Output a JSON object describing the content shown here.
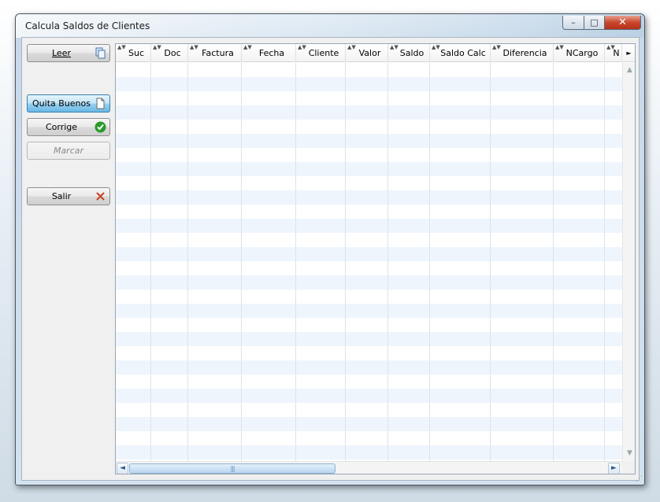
{
  "window": {
    "title": "Calcula Saldos de Clientes",
    "controls": {
      "minimize": "–",
      "maximize": "□",
      "close": "✕"
    }
  },
  "sidebar": {
    "buttons": [
      {
        "id": "leer",
        "label": "Leer",
        "icon": "copy-icon",
        "state": "normal"
      },
      {
        "id": "quita-buenos",
        "label": "Quita Buenos",
        "icon": "document-icon",
        "state": "active"
      },
      {
        "id": "corrige",
        "label": "Corrige",
        "icon": "check-circle-icon",
        "state": "normal"
      },
      {
        "id": "marcar",
        "label": "Marcar",
        "icon": "",
        "state": "disabled"
      },
      {
        "id": "salir",
        "label": "Salir",
        "icon": "close-x-icon",
        "state": "normal"
      }
    ]
  },
  "grid": {
    "columns": [
      "Suc",
      "Doc",
      "Factura",
      "Fecha",
      "Cliente",
      "Valor",
      "Saldo",
      "Saldo Calc",
      "Diferencia",
      "NCargo",
      "N"
    ],
    "sort_glyph": "▲▼",
    "scroll_arrows": {
      "left": "◄",
      "right": "►",
      "up": "▲",
      "down": "▼",
      "header_right": "►"
    },
    "grip": "|||"
  },
  "colors": {
    "active_button": "#98d1ef",
    "row_alt": "#eef5fc",
    "check_green": "#2a9a2a",
    "close_red": "#c9462c"
  }
}
